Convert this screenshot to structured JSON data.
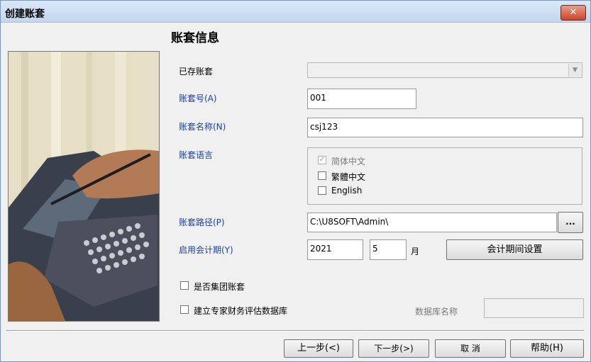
{
  "window": {
    "title": "创建账套",
    "close_label": "✕"
  },
  "heading": "账套信息",
  "fields": {
    "existing_label": "已存账套",
    "existing_value": "",
    "code_label": "账套号(A)",
    "code_value": "001",
    "name_label": "账套名称(N)",
    "name_value": "csj123",
    "language_label": "账套语言",
    "languages": [
      {
        "label": "简体中文",
        "checked": true,
        "disabled": true
      },
      {
        "label": "繁體中文",
        "checked": false,
        "disabled": false
      },
      {
        "label": "English",
        "checked": false,
        "disabled": false
      }
    ],
    "path_label": "账套路径(P)",
    "path_value": "C:\\U8SOFT\\Admin\\",
    "browse_label": "...",
    "period_label": "启用会计期(Y)",
    "year_value": "2021",
    "month_value": "5",
    "month_unit": "月",
    "period_settings_button": "会计期间设置",
    "group_account_label": "是否集团账套",
    "expert_db_label": "建立专家财务评估数据库",
    "db_name_label": "数据库名称",
    "db_name_value": ""
  },
  "buttons": {
    "prev": "上一步(<)",
    "next": "下一步(>)",
    "cancel": "取 消",
    "help": "帮助(H)"
  },
  "colors": {
    "accent_label": "#1a3ea8",
    "titlebar": "#c3d6ef",
    "close_button": "#c9462b"
  }
}
